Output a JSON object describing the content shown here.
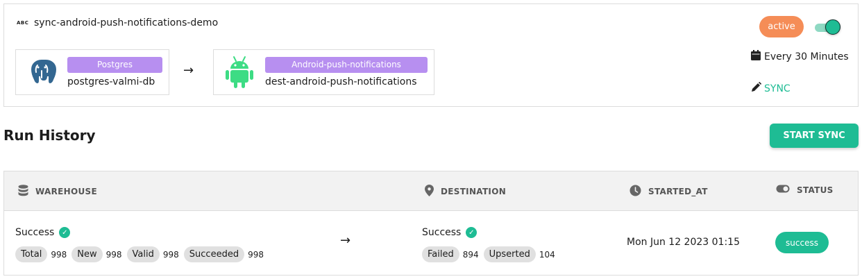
{
  "sync": {
    "name": "sync-android-push-notifications-demo",
    "name_type_icon": "ABC",
    "source": {
      "tag": "Postgres",
      "name": "postgres-valmi-db",
      "icon": "postgres-elephant-icon"
    },
    "destination": {
      "tag": "Android-push-notifications",
      "name": "dest-android-push-notifications",
      "icon": "android-robot-icon"
    },
    "state_label": "active",
    "enabled": true,
    "schedule": "Every 30 Minutes",
    "edit_link": "SYNC"
  },
  "run_history": {
    "title": "Run History",
    "start_button": "START SYNC",
    "columns": {
      "warehouse": "WAREHOUSE",
      "destination": "DESTINATION",
      "started_at": "STARTED_AT",
      "status": "STATUS"
    },
    "rows": [
      {
        "warehouse": {
          "status": "Success",
          "metrics": [
            {
              "label": "Total",
              "value": "998"
            },
            {
              "label": "New",
              "value": "998"
            },
            {
              "label": "Valid",
              "value": "998"
            },
            {
              "label": "Succeeded",
              "value": "998"
            }
          ]
        },
        "destination": {
          "status": "Success",
          "metrics": [
            {
              "label": "Failed",
              "value": "894"
            },
            {
              "label": "Upserted",
              "value": "104"
            }
          ]
        },
        "started_at": "Mon Jun 12 2023 01:15",
        "status": "success"
      }
    ]
  },
  "colors": {
    "accent_green": "#1ebc94",
    "active_orange": "#f58d57",
    "tag_purple": "#b78ff0",
    "android_green": "#3ddc84",
    "postgres_blue": "#336791"
  }
}
